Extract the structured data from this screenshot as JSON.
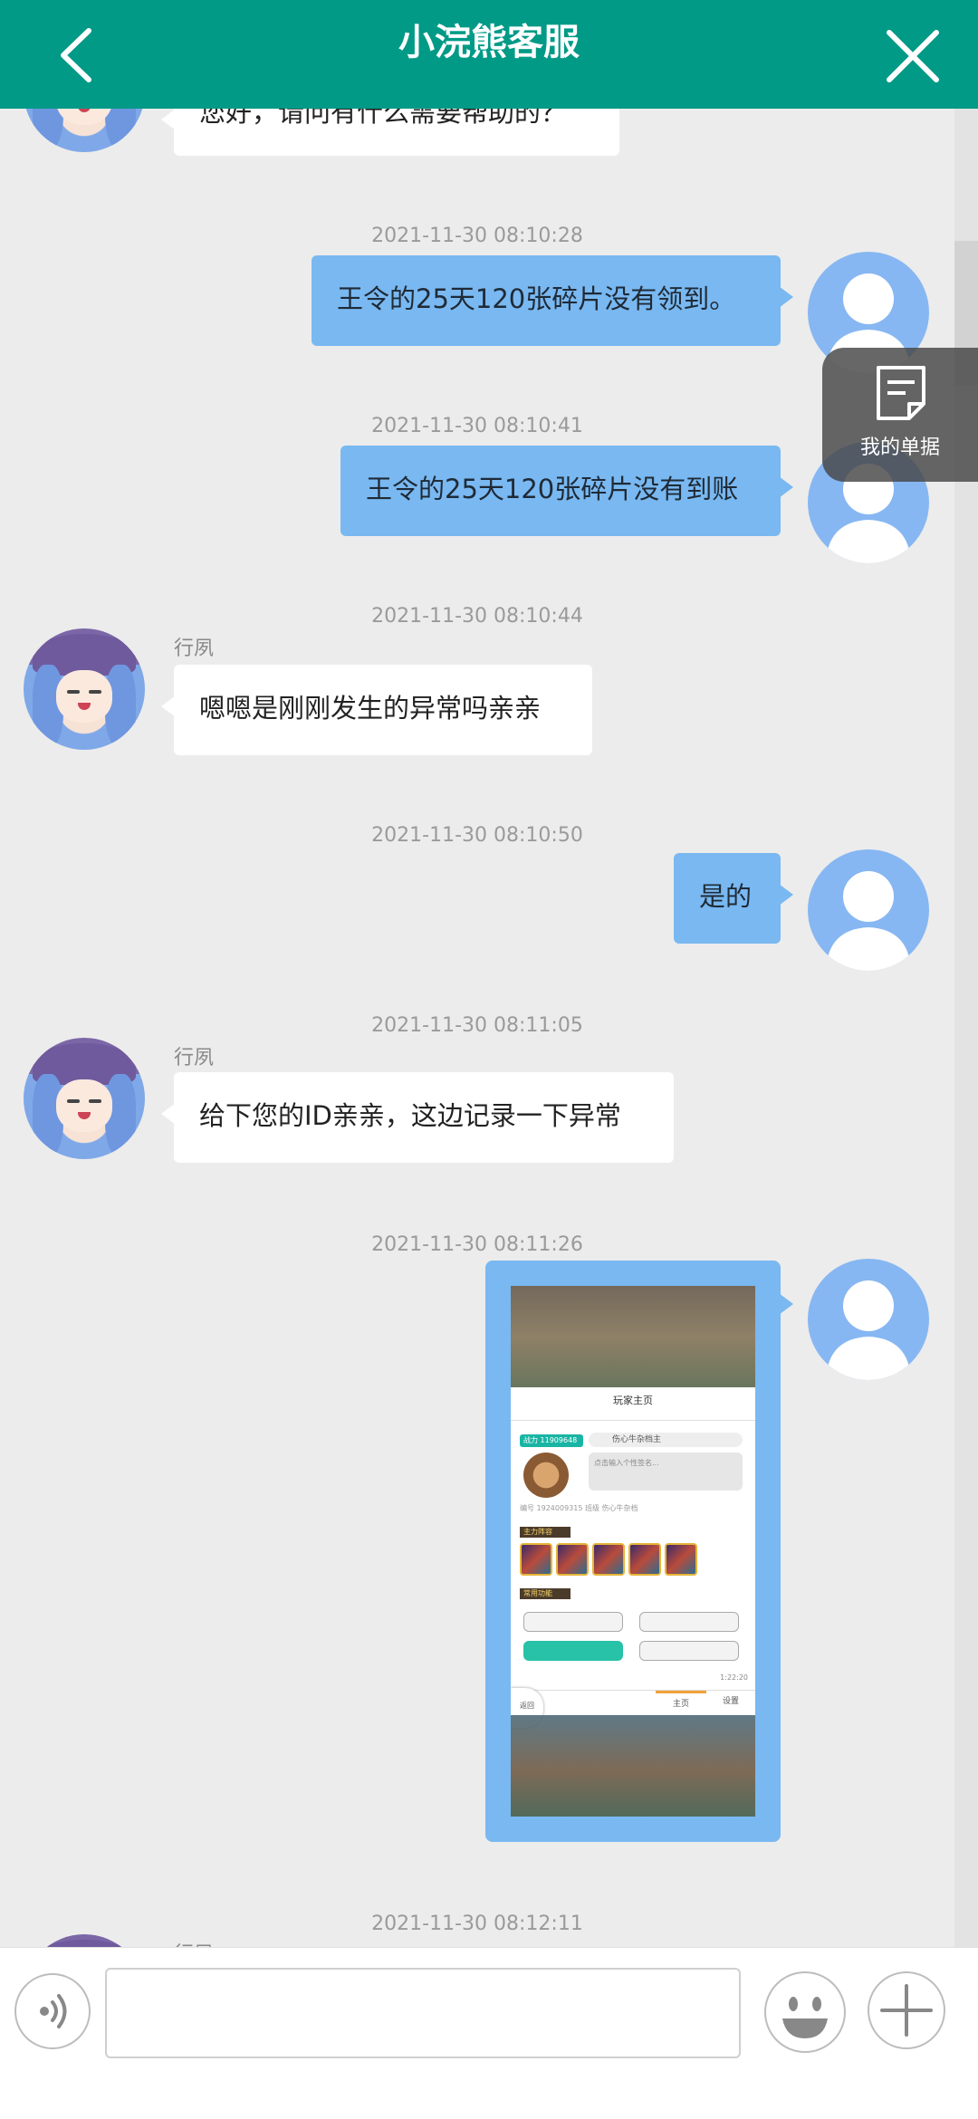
{
  "header": {
    "title": "小浣熊客服"
  },
  "floating": {
    "receipt_label": "我的单据"
  },
  "messages": [
    {
      "side": "agent",
      "text": "您好，请问有什么需要帮助的？"
    },
    {
      "side": "user",
      "timestamp": "2021-11-30 08:10:28",
      "text": "王令的25天120张碎片没有领到。"
    },
    {
      "side": "user",
      "timestamp": "2021-11-30 08:10:41",
      "text": "王令的25天120张碎片没有到账"
    },
    {
      "side": "agent",
      "timestamp": "2021-11-30 08:10:44",
      "name": "行夙",
      "text": "嗯嗯是刚刚发生的异常吗亲亲"
    },
    {
      "side": "user",
      "timestamp": "2021-11-30 08:10:50",
      "text": "是的"
    },
    {
      "side": "agent",
      "timestamp": "2021-11-30 08:11:05",
      "name": "行夙",
      "text": "给下您的ID亲亲，这边记录一下异常"
    },
    {
      "side": "user",
      "timestamp": "2021-11-30 08:11:26",
      "type": "image"
    },
    {
      "side": "agent",
      "timestamp": "2021-11-30 08:12:11",
      "name": "行夙"
    }
  ],
  "screenshot": {
    "title": "玩家主页",
    "power": "战力 11909648",
    "player_name": "伤心牛杂档主",
    "signature_placeholder": "点击输入个性签名...",
    "meta": "编号 1924009315  班级 伤心牛杂档",
    "tag_main": "主力阵容",
    "tag_common": "常用功能",
    "tab_home": "主页",
    "tab_settings": "设置",
    "back": "返回",
    "time": "1:22:20"
  },
  "input": {
    "value": "",
    "placeholder": ""
  },
  "colors": {
    "header": "#009a86",
    "user_bubble": "#79b8f1",
    "agent_bubble": "#ffffff",
    "background": "#ececec"
  },
  "icons": {
    "back": "chevron-left-icon",
    "close": "close-icon",
    "receipt": "document-icon",
    "voice": "voice-icon",
    "emoji": "emoji-icon",
    "plus": "plus-icon"
  }
}
